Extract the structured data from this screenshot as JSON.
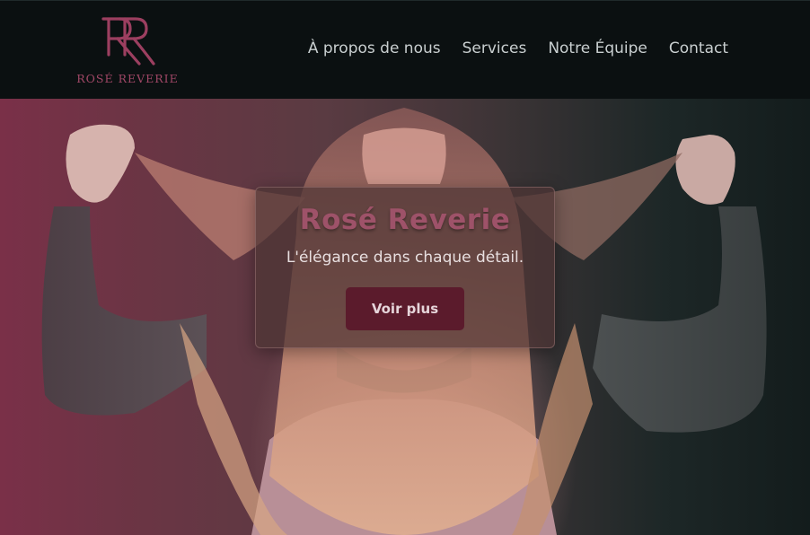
{
  "brand": {
    "monogram": "RR",
    "name": "ROSÉ REVERIE",
    "color": "#a04766"
  },
  "nav": {
    "items": [
      {
        "label": "À propos de nous"
      },
      {
        "label": "Services"
      },
      {
        "label": "Notre Équipe"
      },
      {
        "label": "Contact"
      }
    ]
  },
  "hero": {
    "title": "Rosé Reverie",
    "tagline": "L'élégance dans chaque détail.",
    "button_label": "Voir plus",
    "accent_color": "#9e5269",
    "button_color": "#5b1b2c"
  }
}
